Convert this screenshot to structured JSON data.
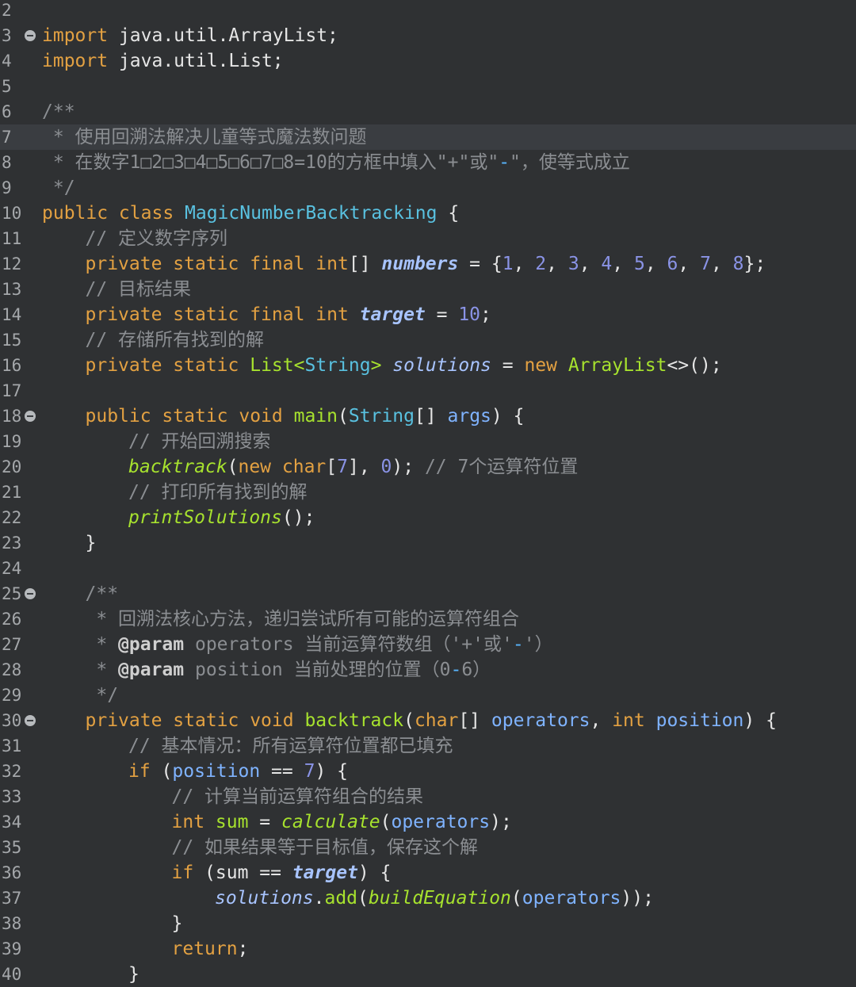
{
  "editor": {
    "lines": [
      {
        "num": "2",
        "fold": false,
        "highlight": false,
        "indent": 0,
        "tokens": []
      },
      {
        "num": "3",
        "fold": true,
        "highlight": false,
        "indent": 0,
        "tokens": [
          {
            "t": "import",
            "c": "kw"
          },
          {
            "t": " java.util.ArrayList;",
            "c": ""
          }
        ]
      },
      {
        "num": "4",
        "fold": false,
        "highlight": false,
        "indent": 0,
        "tokens": [
          {
            "t": "import",
            "c": "kw"
          },
          {
            "t": " java.util.List;",
            "c": ""
          }
        ]
      },
      {
        "num": "5",
        "fold": false,
        "highlight": false,
        "indent": 0,
        "tokens": []
      },
      {
        "num": "6",
        "fold": false,
        "highlight": false,
        "indent": 0,
        "tokens": [
          {
            "t": "/**",
            "c": "cm"
          }
        ]
      },
      {
        "num": "7",
        "fold": false,
        "highlight": true,
        "indent": 0,
        "tokens": [
          {
            "t": " * 使用回溯法解决儿童等式魔法数问题",
            "c": "cm"
          }
        ]
      },
      {
        "num": "8",
        "fold": false,
        "highlight": false,
        "indent": 0,
        "tokens": [
          {
            "t": " * 在数字1□2□3□4□5□6□7□8=10的方框中填入\"+\"或\"",
            "c": "cm"
          },
          {
            "t": "-",
            "c": "dash"
          },
          {
            "t": "\"，使等式成立",
            "c": "cm"
          }
        ]
      },
      {
        "num": "9",
        "fold": false,
        "highlight": false,
        "indent": 0,
        "tokens": [
          {
            "t": " */",
            "c": "cm"
          }
        ]
      },
      {
        "num": "10",
        "fold": false,
        "highlight": false,
        "indent": 0,
        "tokens": [
          {
            "t": "public class ",
            "c": "kw"
          },
          {
            "t": "MagicNumberBacktracking",
            "c": "ty"
          },
          {
            "t": " {",
            "c": ""
          }
        ]
      },
      {
        "num": "11",
        "fold": false,
        "highlight": false,
        "indent": 1,
        "tokens": [
          {
            "t": "// 定义数字序列",
            "c": "cm"
          }
        ]
      },
      {
        "num": "12",
        "fold": false,
        "highlight": false,
        "indent": 1,
        "tokens": [
          {
            "t": "private static final int",
            "c": "kw"
          },
          {
            "t": "[] ",
            "c": ""
          },
          {
            "t": "numbers",
            "c": "it"
          },
          {
            "t": " = {",
            "c": ""
          },
          {
            "t": "1",
            "c": "nm"
          },
          {
            "t": ", ",
            "c": ""
          },
          {
            "t": "2",
            "c": "nm"
          },
          {
            "t": ", ",
            "c": ""
          },
          {
            "t": "3",
            "c": "nm"
          },
          {
            "t": ", ",
            "c": ""
          },
          {
            "t": "4",
            "c": "nm"
          },
          {
            "t": ", ",
            "c": ""
          },
          {
            "t": "5",
            "c": "nm"
          },
          {
            "t": ", ",
            "c": ""
          },
          {
            "t": "6",
            "c": "nm"
          },
          {
            "t": ", ",
            "c": ""
          },
          {
            "t": "7",
            "c": "nm"
          },
          {
            "t": ", ",
            "c": ""
          },
          {
            "t": "8",
            "c": "nm"
          },
          {
            "t": "};",
            "c": ""
          }
        ]
      },
      {
        "num": "13",
        "fold": false,
        "highlight": false,
        "indent": 1,
        "tokens": [
          {
            "t": "// 目标结果",
            "c": "cm"
          }
        ]
      },
      {
        "num": "14",
        "fold": false,
        "highlight": false,
        "indent": 1,
        "tokens": [
          {
            "t": "private static final int ",
            "c": "kw"
          },
          {
            "t": "target",
            "c": "it"
          },
          {
            "t": " = ",
            "c": ""
          },
          {
            "t": "10",
            "c": "nm"
          },
          {
            "t": ";",
            "c": ""
          }
        ]
      },
      {
        "num": "15",
        "fold": false,
        "highlight": false,
        "indent": 1,
        "tokens": [
          {
            "t": "// 存储所有找到的解",
            "c": "cm"
          }
        ]
      },
      {
        "num": "16",
        "fold": false,
        "highlight": false,
        "indent": 1,
        "tokens": [
          {
            "t": "private static ",
            "c": "kw"
          },
          {
            "t": "List<",
            "c": "fn"
          },
          {
            "t": "String",
            "c": "ty"
          },
          {
            "t": "> ",
            "c": "fn"
          },
          {
            "t": "solutions",
            "c": "sf"
          },
          {
            "t": " = ",
            "c": ""
          },
          {
            "t": "new ",
            "c": "kw"
          },
          {
            "t": "ArrayList",
            "c": "fn"
          },
          {
            "t": "<>();",
            "c": ""
          }
        ]
      },
      {
        "num": "17",
        "fold": false,
        "highlight": false,
        "indent": 0,
        "tokens": []
      },
      {
        "num": "18",
        "fold": true,
        "highlight": false,
        "indent": 1,
        "tokens": [
          {
            "t": "public static void ",
            "c": "kw"
          },
          {
            "t": "main",
            "c": "fn"
          },
          {
            "t": "(",
            "c": ""
          },
          {
            "t": "String",
            "c": "ty"
          },
          {
            "t": "[] ",
            "c": ""
          },
          {
            "t": "args",
            "c": "vr"
          },
          {
            "t": ") {",
            "c": ""
          }
        ]
      },
      {
        "num": "19",
        "fold": false,
        "highlight": false,
        "indent": 2,
        "tokens": [
          {
            "t": "// 开始回溯搜索",
            "c": "cm"
          }
        ]
      },
      {
        "num": "20",
        "fold": false,
        "highlight": false,
        "indent": 2,
        "tokens": [
          {
            "t": "backtrack",
            "c": "fi"
          },
          {
            "t": "(",
            "c": ""
          },
          {
            "t": "new ",
            "c": "kw"
          },
          {
            "t": "char",
            "c": "kw"
          },
          {
            "t": "[",
            "c": ""
          },
          {
            "t": "7",
            "c": "nm"
          },
          {
            "t": "], ",
            "c": ""
          },
          {
            "t": "0",
            "c": "nm"
          },
          {
            "t": "); ",
            "c": ""
          },
          {
            "t": "// 7个运算符位置",
            "c": "cm"
          }
        ]
      },
      {
        "num": "21",
        "fold": false,
        "highlight": false,
        "indent": 2,
        "tokens": [
          {
            "t": "// 打印所有找到的解",
            "c": "cm"
          }
        ]
      },
      {
        "num": "22",
        "fold": false,
        "highlight": false,
        "indent": 2,
        "tokens": [
          {
            "t": "printSolutions",
            "c": "fi"
          },
          {
            "t": "();",
            "c": ""
          }
        ]
      },
      {
        "num": "23",
        "fold": false,
        "highlight": false,
        "indent": 1,
        "tokens": [
          {
            "t": "}",
            "c": ""
          }
        ]
      },
      {
        "num": "24",
        "fold": false,
        "highlight": false,
        "indent": 0,
        "tokens": []
      },
      {
        "num": "25",
        "fold": true,
        "highlight": false,
        "indent": 1,
        "tokens": [
          {
            "t": "/**",
            "c": "cm"
          }
        ]
      },
      {
        "num": "26",
        "fold": false,
        "highlight": false,
        "indent": 1,
        "tokens": [
          {
            "t": " * 回溯法核心方法，递归尝试所有可能的运算符组合",
            "c": "cm"
          }
        ]
      },
      {
        "num": "27",
        "fold": false,
        "highlight": false,
        "indent": 1,
        "tokens": [
          {
            "t": " * ",
            "c": "cm"
          },
          {
            "t": "@param",
            "c": "an"
          },
          {
            "t": " operators 当前运算符数组（'+'或'",
            "c": "cm"
          },
          {
            "t": "-",
            "c": "dash"
          },
          {
            "t": "'）",
            "c": "cm"
          }
        ]
      },
      {
        "num": "28",
        "fold": false,
        "highlight": false,
        "indent": 1,
        "tokens": [
          {
            "t": " * ",
            "c": "cm"
          },
          {
            "t": "@param",
            "c": "an"
          },
          {
            "t": " position 当前处理的位置（0",
            "c": "cm"
          },
          {
            "t": "-",
            "c": "dash"
          },
          {
            "t": "6）",
            "c": "cm"
          }
        ]
      },
      {
        "num": "29",
        "fold": false,
        "highlight": false,
        "indent": 1,
        "tokens": [
          {
            "t": " */",
            "c": "cm"
          }
        ]
      },
      {
        "num": "30",
        "fold": true,
        "highlight": false,
        "indent": 1,
        "tokens": [
          {
            "t": "private static void ",
            "c": "kw"
          },
          {
            "t": "backtrack",
            "c": "fn"
          },
          {
            "t": "(",
            "c": ""
          },
          {
            "t": "char",
            "c": "kw"
          },
          {
            "t": "[] ",
            "c": ""
          },
          {
            "t": "operators",
            "c": "vr"
          },
          {
            "t": ", ",
            "c": ""
          },
          {
            "t": "int ",
            "c": "kw"
          },
          {
            "t": "position",
            "c": "vr"
          },
          {
            "t": ") {",
            "c": ""
          }
        ]
      },
      {
        "num": "31",
        "fold": false,
        "highlight": false,
        "indent": 2,
        "tokens": [
          {
            "t": "// 基本情况：所有运算符位置都已填充",
            "c": "cm"
          }
        ]
      },
      {
        "num": "32",
        "fold": false,
        "highlight": false,
        "indent": 2,
        "tokens": [
          {
            "t": "if ",
            "c": "kw"
          },
          {
            "t": "(",
            "c": ""
          },
          {
            "t": "position",
            "c": "vr"
          },
          {
            "t": " == ",
            "c": ""
          },
          {
            "t": "7",
            "c": "nm"
          },
          {
            "t": ") {",
            "c": ""
          }
        ]
      },
      {
        "num": "33",
        "fold": false,
        "highlight": false,
        "indent": 3,
        "tokens": [
          {
            "t": "// 计算当前运算符组合的结果",
            "c": "cm"
          }
        ]
      },
      {
        "num": "34",
        "fold": false,
        "highlight": false,
        "indent": 3,
        "tokens": [
          {
            "t": "int ",
            "c": "kw"
          },
          {
            "t": "sum",
            "c": "fn"
          },
          {
            "t": " = ",
            "c": ""
          },
          {
            "t": "calculate",
            "c": "fi"
          },
          {
            "t": "(",
            "c": ""
          },
          {
            "t": "operators",
            "c": "vr"
          },
          {
            "t": ");",
            "c": ""
          }
        ]
      },
      {
        "num": "35",
        "fold": false,
        "highlight": false,
        "indent": 3,
        "tokens": [
          {
            "t": "// 如果结果等于目标值，保存这个解",
            "c": "cm"
          }
        ]
      },
      {
        "num": "36",
        "fold": false,
        "highlight": false,
        "indent": 3,
        "tokens": [
          {
            "t": "if ",
            "c": "kw"
          },
          {
            "t": "(sum == ",
            "c": ""
          },
          {
            "t": "target",
            "c": "it"
          },
          {
            "t": ") {",
            "c": ""
          }
        ]
      },
      {
        "num": "37",
        "fold": false,
        "highlight": false,
        "indent": 4,
        "tokens": [
          {
            "t": "solutions",
            "c": "sf"
          },
          {
            "t": ".",
            "c": ""
          },
          {
            "t": "add",
            "c": "fn"
          },
          {
            "t": "(",
            "c": ""
          },
          {
            "t": "buildEquation",
            "c": "fi"
          },
          {
            "t": "(",
            "c": ""
          },
          {
            "t": "operators",
            "c": "vr"
          },
          {
            "t": "));",
            "c": ""
          }
        ]
      },
      {
        "num": "38",
        "fold": false,
        "highlight": false,
        "indent": 3,
        "tokens": [
          {
            "t": "}",
            "c": ""
          }
        ]
      },
      {
        "num": "39",
        "fold": false,
        "highlight": false,
        "indent": 3,
        "tokens": [
          {
            "t": "return",
            "c": "kw"
          },
          {
            "t": ";",
            "c": ""
          }
        ]
      },
      {
        "num": "40",
        "fold": false,
        "highlight": false,
        "indent": 2,
        "tokens": [
          {
            "t": "}",
            "c": ""
          }
        ]
      }
    ]
  },
  "colors": {
    "background": "#2f3133",
    "keyword": "#e3a142",
    "comment": "#8b8e92",
    "type": "#59c1e0",
    "number": "#8a93e6",
    "method": "#a7e22e",
    "field": "#a8c4ff"
  },
  "icons": {
    "fold": "fold-collapse-icon"
  }
}
